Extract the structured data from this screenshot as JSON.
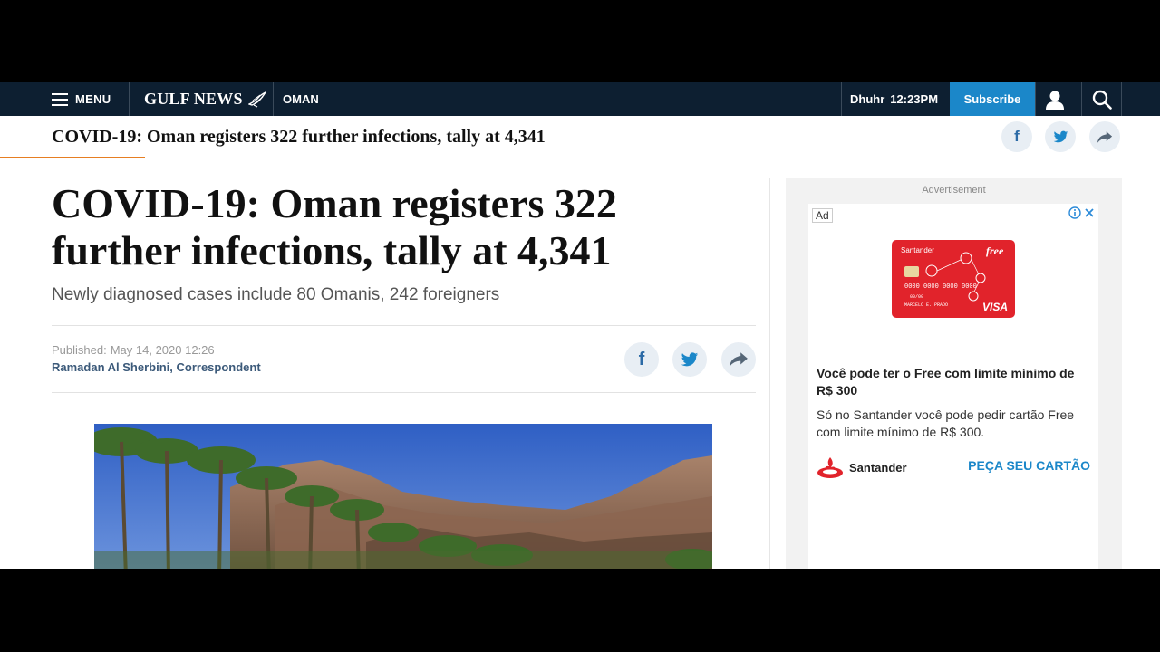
{
  "nav": {
    "menu_label": "MENU",
    "logo_text": "GULF NEWS",
    "section": "OMAN",
    "prayer_name": "Dhuhr",
    "prayer_time": "12:23PM",
    "subscribe_label": "Subscribe"
  },
  "sticky": {
    "title": "COVID-19: Oman registers 322 further infections, tally at 4,341"
  },
  "article": {
    "headline": "COVID-19: Oman registers 322 further infections, tally at 4,341",
    "subhead": "Newly diagnosed cases include 80 Omanis, 242 foreigners",
    "published_label": "Published:",
    "published_date": "May 14, 2020 12:26",
    "author": "Ramadan Al Sherbini, Correspondent"
  },
  "ad": {
    "label": "Advertisement",
    "badge": "Ad",
    "card_brand": "Santander",
    "card_product": "free",
    "card_network": "VISA",
    "card_number": "0000 0000 0000 0000",
    "card_holder": "MARCELO E. PRADO",
    "card_expiry": "00/00",
    "title": "Você pode ter o Free com limite mínimo de R$ 300",
    "body": "Só no Santander você pode pedir cartão Free com limite mínimo de R$ 300.",
    "brand": "Santander",
    "cta": "PEÇA SEU CARTÃO"
  },
  "colors": {
    "nav_bg": "#0d1f31",
    "subscribe_bg": "#1b87c9",
    "progress": "#e67e22",
    "ad_card": "#e1232b",
    "author_link": "#3c5a7a"
  },
  "icons": [
    "menu-icon",
    "logo-bird-icon",
    "user-icon",
    "search-icon",
    "facebook-icon",
    "twitter-icon",
    "share-icon",
    "adchoices-icon",
    "close-icon",
    "santander-flame-icon"
  ]
}
